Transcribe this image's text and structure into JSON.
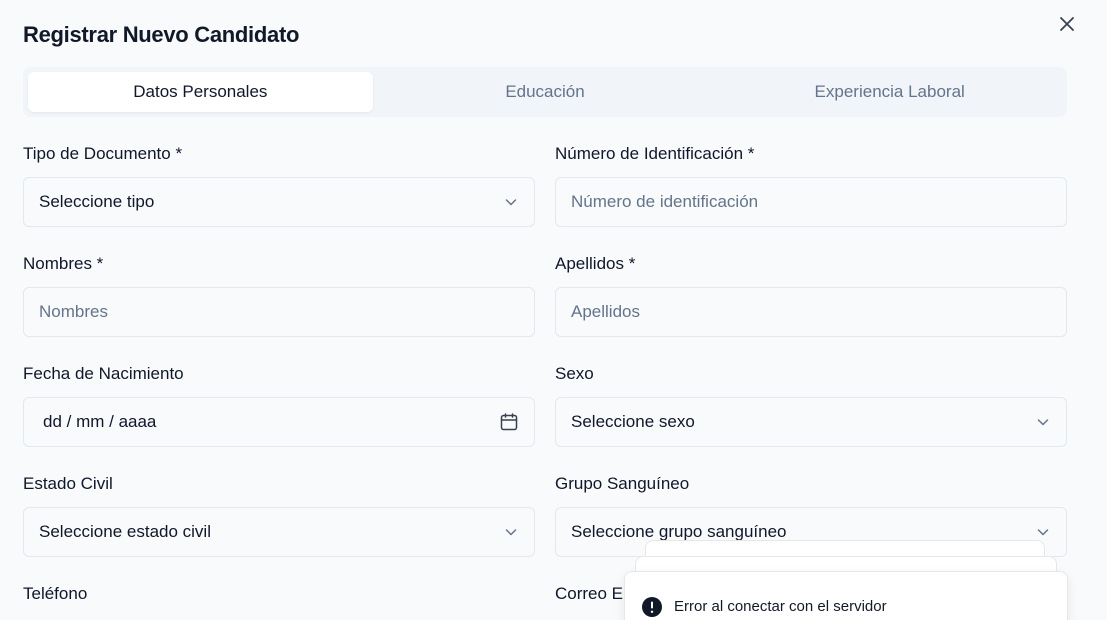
{
  "dialog": {
    "title": "Registrar Nuevo Candidato",
    "close_icon": "close-icon"
  },
  "tabs": [
    {
      "label": "Datos Personales",
      "active": true
    },
    {
      "label": "Educación",
      "active": false
    },
    {
      "label": "Experiencia Laboral",
      "active": false
    }
  ],
  "form": {
    "tipo_documento": {
      "label": "Tipo de Documento *",
      "value": "Seleccione tipo"
    },
    "numero_identificacion": {
      "label": "Número de Identificación *",
      "placeholder": "Número de identificación"
    },
    "nombres": {
      "label": "Nombres *",
      "placeholder": "Nombres"
    },
    "apellidos": {
      "label": "Apellidos *",
      "placeholder": "Apellidos"
    },
    "fecha_nacimiento": {
      "label": "Fecha de Nacimiento",
      "value": "dd / mm / aaaa"
    },
    "sexo": {
      "label": "Sexo",
      "value": "Seleccione sexo"
    },
    "estado_civil": {
      "label": "Estado Civil",
      "value": "Seleccione estado civil"
    },
    "grupo_sanguineo": {
      "label": "Grupo Sanguíneo",
      "value": "Seleccione grupo sanguíneo"
    },
    "telefono": {
      "label": "Teléfono"
    },
    "correo": {
      "label": "Correo E"
    }
  },
  "toast": {
    "message": "Error al conectar con el servidor",
    "icon": "alert-circle-icon",
    "color": "#111827"
  }
}
